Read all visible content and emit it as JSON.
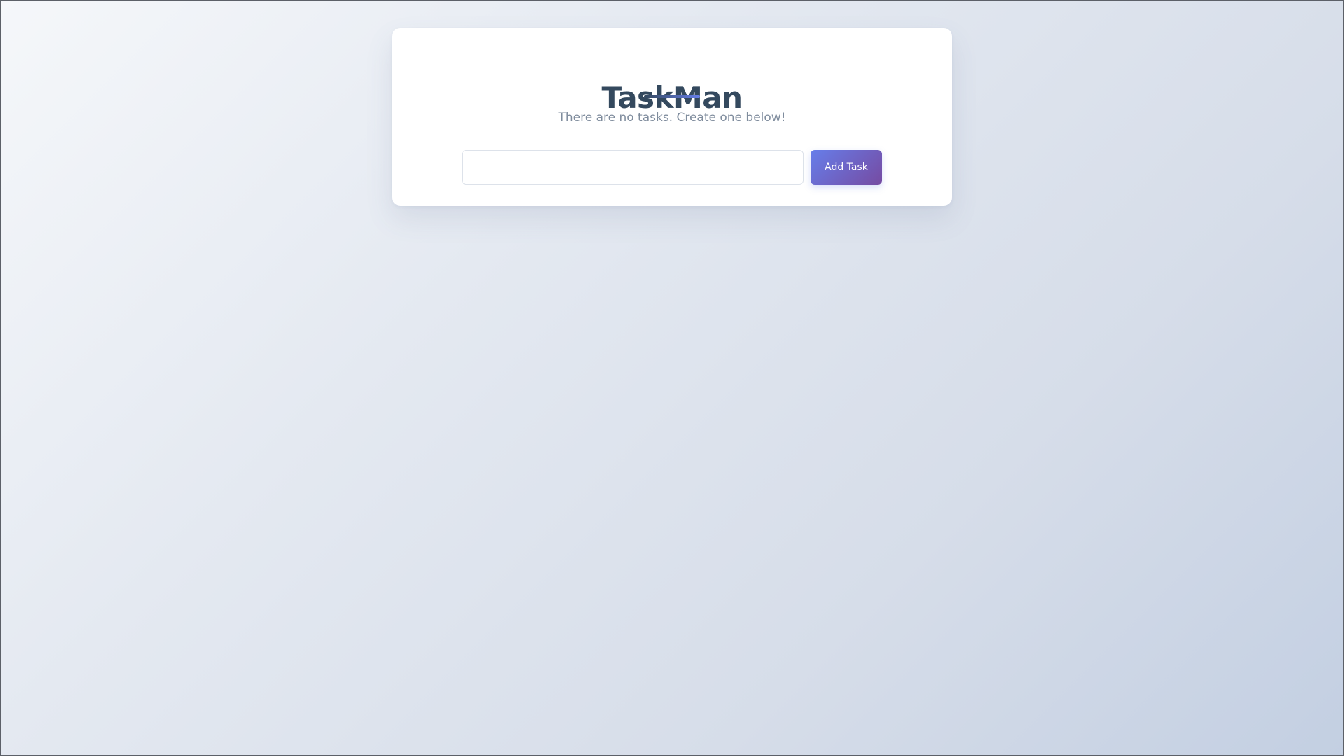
{
  "app": {
    "title": "TaskMan",
    "empty_message": "There are no tasks. Create one below!"
  },
  "task_form": {
    "input_value": "",
    "input_placeholder": "",
    "add_button_label": "Add Task"
  },
  "colors": {
    "title": "#34495e",
    "accent_start": "#667eea",
    "accent_end": "#764ba2",
    "message": "#7f8c9d",
    "card": "#ffffff"
  }
}
